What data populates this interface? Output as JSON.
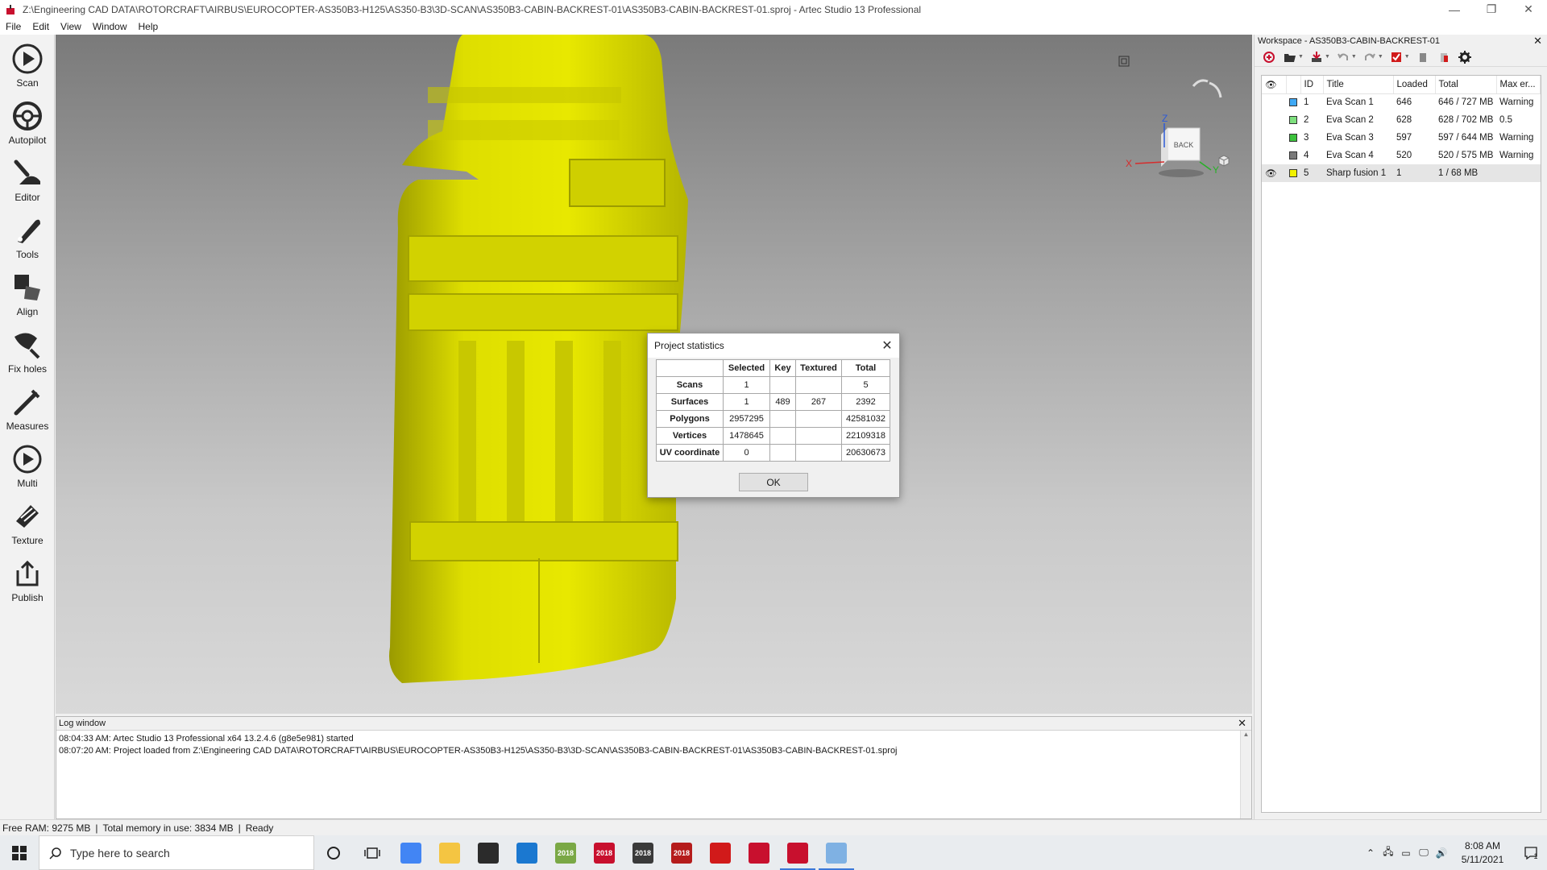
{
  "window": {
    "title": "Z:\\Engineering CAD DATA\\ROTORCRAFT\\AIRBUS\\EUROCOPTER-AS350B3-H125\\AS350-B3\\3D-SCAN\\AS350B3-CABIN-BACKREST-01\\AS350B3-CABIN-BACKREST-01.sproj - Artec Studio 13 Professional",
    "minimize": "—",
    "restore": "❐",
    "close": "✕"
  },
  "menu": [
    "File",
    "Edit",
    "View",
    "Window",
    "Help"
  ],
  "toolbar": [
    {
      "label": "Scan",
      "icon": "scan-icon"
    },
    {
      "label": "Autopilot",
      "icon": "autopilot-icon"
    },
    {
      "label": "Editor",
      "icon": "editor-icon"
    },
    {
      "label": "Tools",
      "icon": "tools-icon"
    },
    {
      "label": "Align",
      "icon": "align-icon"
    },
    {
      "label": "Fix holes",
      "icon": "fix-holes-icon"
    },
    {
      "label": "Measures",
      "icon": "measures-icon"
    },
    {
      "label": "Multi",
      "icon": "multi-icon"
    },
    {
      "label": "Texture",
      "icon": "texture-icon"
    },
    {
      "label": "Publish",
      "icon": "publish-icon"
    }
  ],
  "viewport": {
    "nav_cube": {
      "face": "BACK",
      "x": "X",
      "y": "Y",
      "z": "Z"
    },
    "model_color": "#e0e000"
  },
  "dialog": {
    "title": "Project statistics",
    "ok_label": "OK",
    "headers": [
      "",
      "Selected",
      "Key",
      "Textured",
      "Total"
    ],
    "rows": [
      [
        "Scans",
        "1",
        "",
        "",
        "5"
      ],
      [
        "Surfaces",
        "1",
        "489",
        "267",
        "2392"
      ],
      [
        "Polygons",
        "2957295",
        "",
        "",
        "42581032"
      ],
      [
        "Vertices",
        "1478645",
        "",
        "",
        "22109318"
      ],
      [
        "UV coordinate",
        "0",
        "",
        "",
        "20630673"
      ]
    ]
  },
  "log": {
    "title": "Log window",
    "lines": [
      "08:04:33 AM: Artec Studio 13 Professional x64 13.2.4.6 (g8e5e981) started",
      "08:07:20 AM: Project loaded from Z:\\Engineering CAD DATA\\ROTORCRAFT\\AIRBUS\\EUROCOPTER-AS350B3-H125\\AS350-B3\\3D-SCAN\\AS350B3-CABIN-BACKREST-01\\AS350B3-CABIN-BACKREST-01.sproj"
    ]
  },
  "status": {
    "free_ram": "Free RAM: 9275 MB",
    "total_memory": "Total memory in use: 3834 MB",
    "state": "Ready"
  },
  "workspace": {
    "title": "Workspace - AS350B3-CABIN-BACKREST-01",
    "columns": [
      "ID",
      "Title",
      "Loaded",
      "Total",
      "Max er..."
    ],
    "rows": [
      {
        "id": "1",
        "title": "Eva Scan 1",
        "loaded": "646",
        "total": "646 / 727 MB",
        "max_error": "Warning",
        "color": "#3fa9f5",
        "visible": false
      },
      {
        "id": "2",
        "title": "Eva Scan 2",
        "loaded": "628",
        "total": "628 / 702 MB",
        "max_error": "0.5",
        "color": "#7ee07e",
        "visible": false
      },
      {
        "id": "3",
        "title": "Eva Scan 3",
        "loaded": "597",
        "total": "597 / 644 MB",
        "max_error": "Warning",
        "color": "#3cc23c",
        "visible": false
      },
      {
        "id": "4",
        "title": "Eva Scan 4",
        "loaded": "520",
        "total": "520 / 575 MB",
        "max_error": "Warning",
        "color": "#7a7a7a",
        "visible": false
      },
      {
        "id": "5",
        "title": "Sharp fusion 1",
        "loaded": "1",
        "total": "1 / 68 MB",
        "max_error": "",
        "color": "#f2f200",
        "visible": true
      }
    ]
  },
  "taskbar": {
    "search_placeholder": "Type here to search",
    "time": "8:08 AM",
    "date": "5/11/2021",
    "notifications": "1",
    "apps": [
      {
        "name": "chrome-icon",
        "color": "#4285f4",
        "text": ""
      },
      {
        "name": "file-explorer-icon",
        "color": "#f4c542",
        "text": ""
      },
      {
        "name": "store-icon",
        "color": "#2b2b2b",
        "text": ""
      },
      {
        "name": "mail-icon",
        "color": "#1b78d0",
        "text": ""
      },
      {
        "name": "app-2018-green-icon",
        "color": "#7aa845",
        "text": "2018"
      },
      {
        "name": "solidworks-2018-icon",
        "color": "#c8102e",
        "text": "2018"
      },
      {
        "name": "app-2018-dark-icon",
        "color": "#3a3a3a",
        "text": "2018"
      },
      {
        "name": "app-2018-red-icon",
        "color": "#b51c1c",
        "text": "2018"
      },
      {
        "name": "red-black-app-icon",
        "color": "#d11a1a",
        "text": ""
      },
      {
        "name": "artec-icon-1",
        "color": "#c8102e",
        "text": ""
      },
      {
        "name": "artec-icon-2",
        "color": "#c8102e",
        "text": ""
      },
      {
        "name": "paint-icon",
        "color": "#7fb1e3",
        "text": ""
      }
    ]
  }
}
